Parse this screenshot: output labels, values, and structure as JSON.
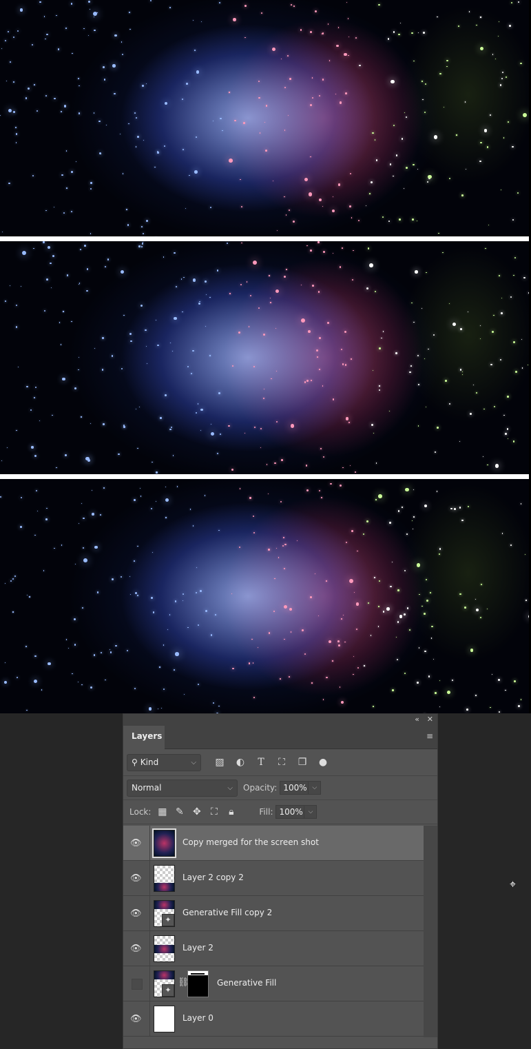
{
  "panel": {
    "collapse_icon": "«",
    "close_icon": "✕",
    "tab": "Layers",
    "menu_icon": "≡",
    "filter": {
      "label": "Kind"
    },
    "blend_mode": "Normal",
    "opacity_label": "Opacity:",
    "opacity": "100%",
    "lock_label": "Lock:",
    "fill_label": "Fill:",
    "fill": "100%"
  },
  "layers": [
    {
      "name": "Copy merged for the screen shot",
      "visible": true,
      "selected": true
    },
    {
      "name": "Layer 2 copy 2",
      "visible": true
    },
    {
      "name": "Generative Fill copy 2",
      "visible": true
    },
    {
      "name": "Layer 2",
      "visible": true
    },
    {
      "name": "Generative Fill",
      "visible": false
    },
    {
      "name": "Layer 0",
      "visible": true
    }
  ]
}
